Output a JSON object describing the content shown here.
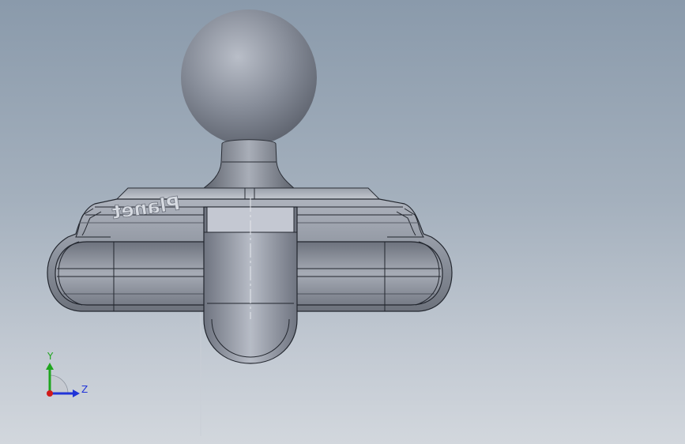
{
  "viewport": {
    "background_top": "#8a9aab",
    "background_bottom": "#d2d7dd",
    "model_color": "#9aa1ad",
    "edge_color": "#1f232b"
  },
  "model": {
    "embossed_text": "Planet",
    "embossed_text_mirrored": true
  },
  "triad": {
    "y_label": "Y",
    "z_label": "Z",
    "y_color": "#1fa51f",
    "z_color": "#2034d8",
    "origin_color": "#d11a1a"
  }
}
